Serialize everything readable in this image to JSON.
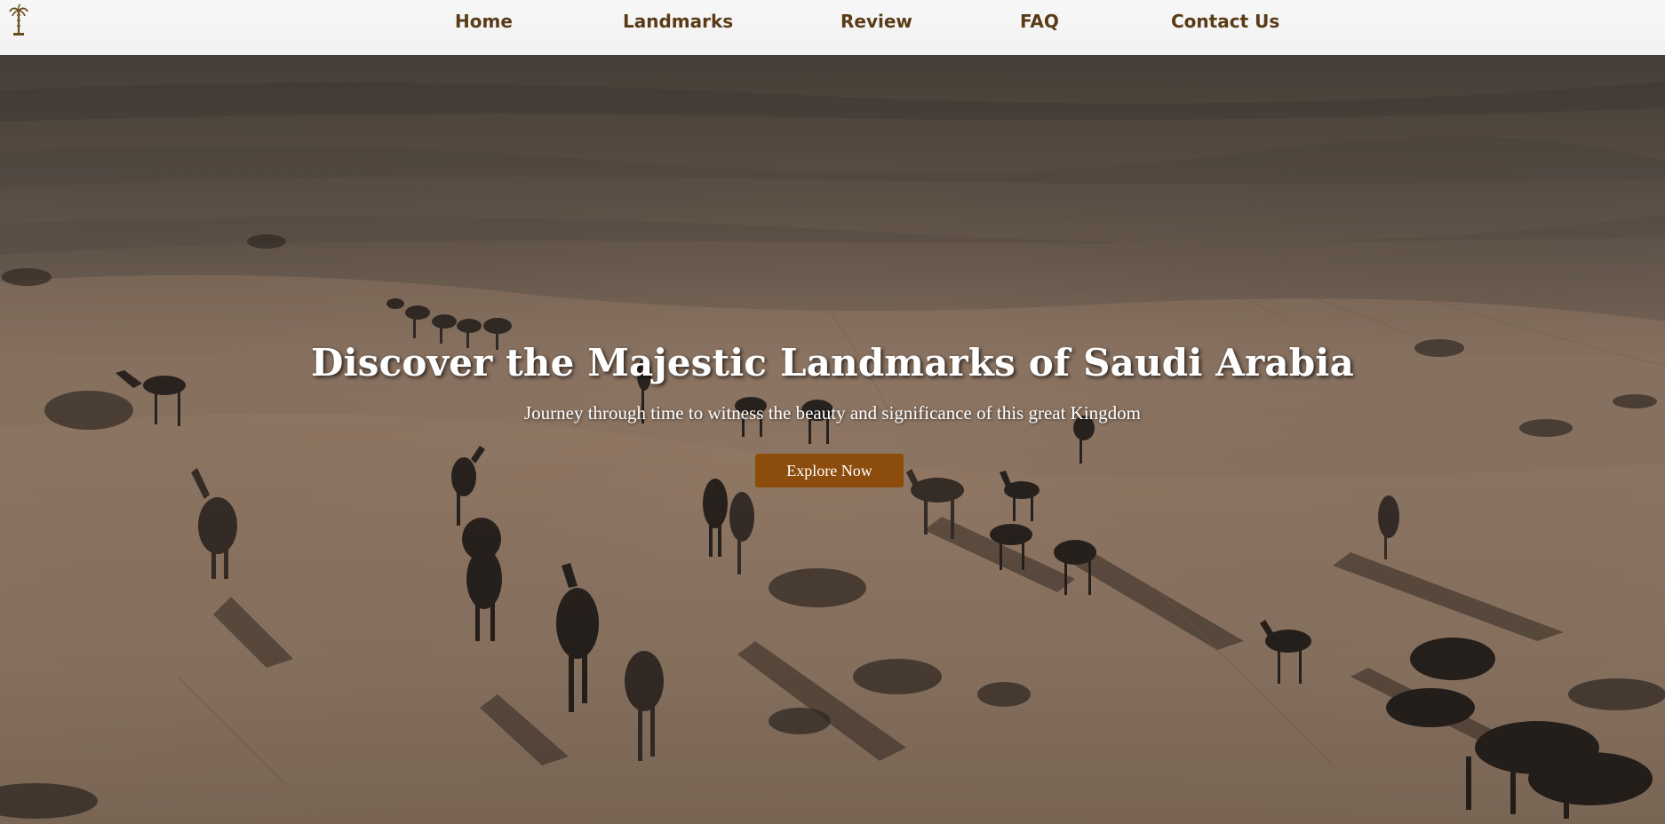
{
  "nav": {
    "logo_icon": "palm-tree-icon",
    "links": [
      {
        "label": "Home"
      },
      {
        "label": "Landmarks"
      },
      {
        "label": "Review"
      },
      {
        "label": "FAQ"
      },
      {
        "label": "Contact Us"
      }
    ]
  },
  "hero": {
    "title": "Discover the Majestic Landmarks of Saudi Arabia",
    "subtitle": "Journey through time to witness the beauty and significance of this great Kingdom",
    "cta_label": "Explore Now"
  },
  "colors": {
    "nav_text": "#5a3b17",
    "cta_background": "#8b4c0c",
    "nav_background": "#f5f5f5"
  }
}
